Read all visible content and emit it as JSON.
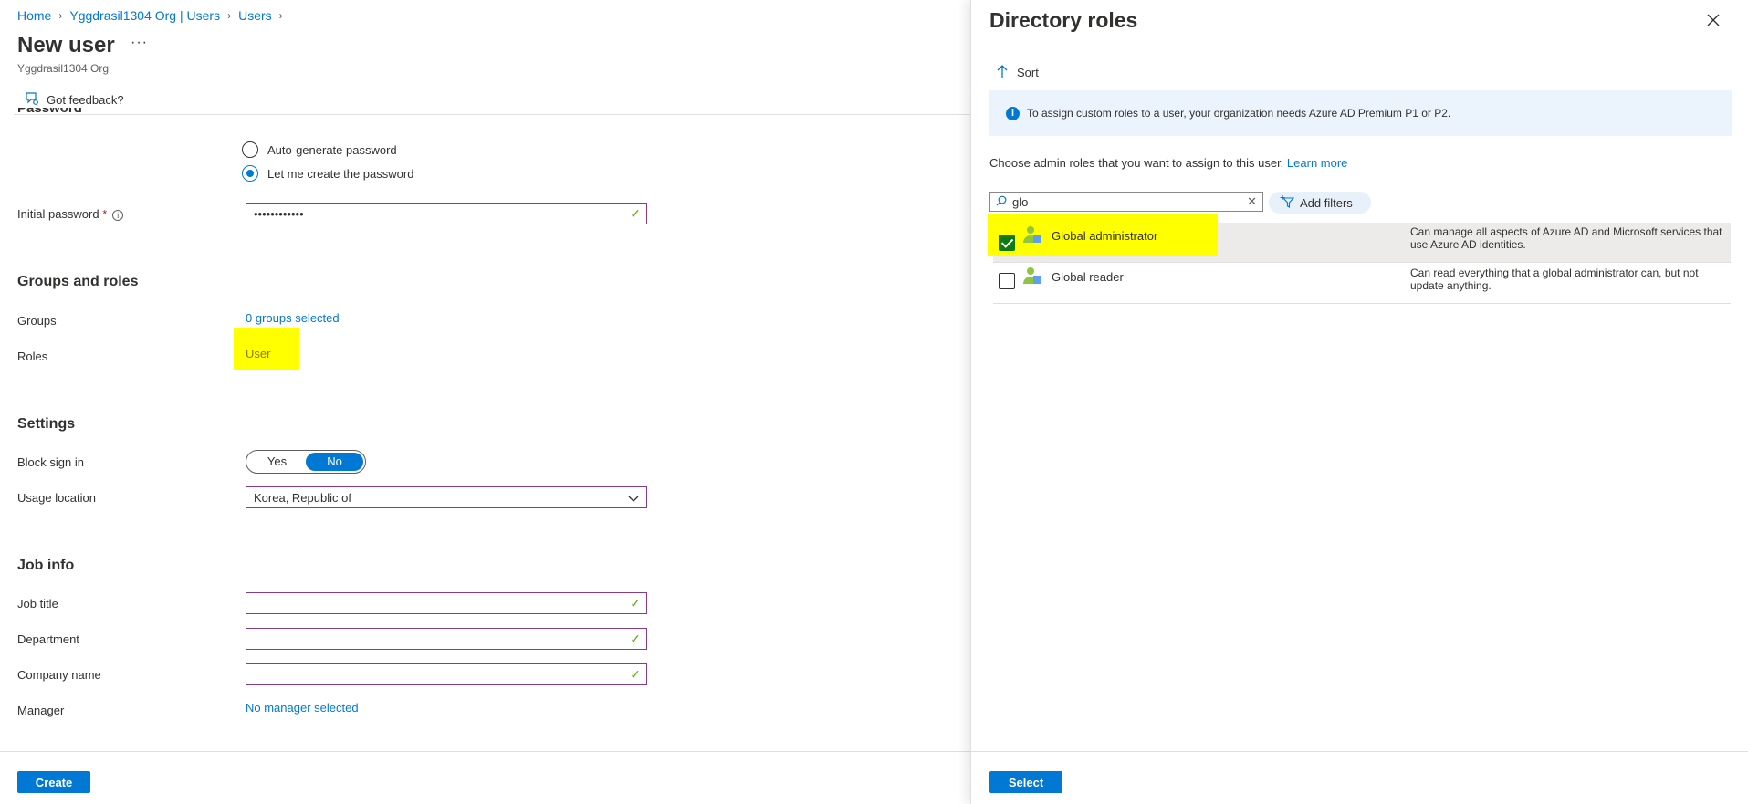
{
  "breadcrumb": {
    "items": [
      "Home",
      "Yggdrasil1304 Org | Users",
      "Users"
    ],
    "separator": ">"
  },
  "page": {
    "title": "New user",
    "more": "···",
    "subtitle": "Yggdrasil1304 Org"
  },
  "toolbar": {
    "feedback_label": "Got feedback?"
  },
  "password": {
    "heading": "Password",
    "options": [
      "Auto-generate password",
      "Let me create the password"
    ],
    "selected_index": 1,
    "initial_label": "Initial password",
    "required_mark": "*",
    "value": "••••••••••••"
  },
  "groups_roles": {
    "heading": "Groups and roles",
    "groups_label": "Groups",
    "groups_value": "0 groups selected",
    "roles_label": "Roles",
    "roles_value": "User"
  },
  "settings": {
    "heading": "Settings",
    "block_label": "Block sign in",
    "toggle_yes": "Yes",
    "toggle_no": "No",
    "toggle_selected": "No",
    "usage_label": "Usage location",
    "usage_value": "Korea, Republic of"
  },
  "job_info": {
    "heading": "Job info",
    "job_title_label": "Job title",
    "department_label": "Department",
    "company_label": "Company name",
    "manager_label": "Manager",
    "manager_value": "No manager selected"
  },
  "footer": {
    "create_label": "Create"
  },
  "panel": {
    "title": "Directory roles",
    "sort_label": "Sort",
    "banner_text": "To assign custom roles to a user, your organization needs Azure AD Premium P1 or P2.",
    "choose_text": "Choose admin roles that you want to assign to this user.",
    "learn_more": "Learn more",
    "search_value": "glo",
    "add_filters_label": "Add filters",
    "roles": [
      {
        "name": "Global administrator",
        "desc": "Can manage all aspects of Azure AD and Microsoft services that use Azure AD identities.",
        "checked": true
      },
      {
        "name": "Global reader",
        "desc": "Can read everything that a global administrator can, but not update anything.",
        "checked": false
      }
    ],
    "select_label": "Select"
  },
  "colors": {
    "accent": "#0078d4",
    "highlight": "#ffff00",
    "field_border": "#8a3a8a",
    "valid_check": "#57a300",
    "checkbox_on": "#0f7b0f"
  }
}
